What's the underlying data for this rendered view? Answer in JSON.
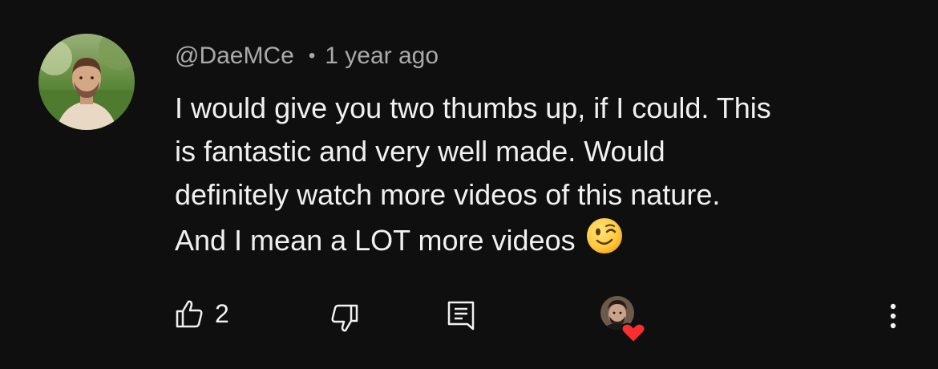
{
  "comment": {
    "author": "@DaeMCe",
    "separator": "•",
    "timestamp": "1 year ago",
    "text_lines": [
      "I would give you two thumbs up, if I could. This",
      "is fantastic and very well made. Would",
      "definitely watch more videos of this nature.",
      "And I mean a LOT more videos"
    ],
    "emoji": "winking-face-emoji"
  },
  "actions": {
    "like_count": "2",
    "like_icon": "thumbs-up-icon",
    "dislike_icon": "thumbs-down-icon",
    "reply_icon": "reply-icon",
    "creator_heart_icon": "creator-heart-icon",
    "more_icon": "more-vertical-icon"
  },
  "colors": {
    "background": "#0f0f0f",
    "primary_text": "#f1f1f1",
    "secondary_text": "#aaaaaa",
    "heart": "#ff2d2d"
  }
}
